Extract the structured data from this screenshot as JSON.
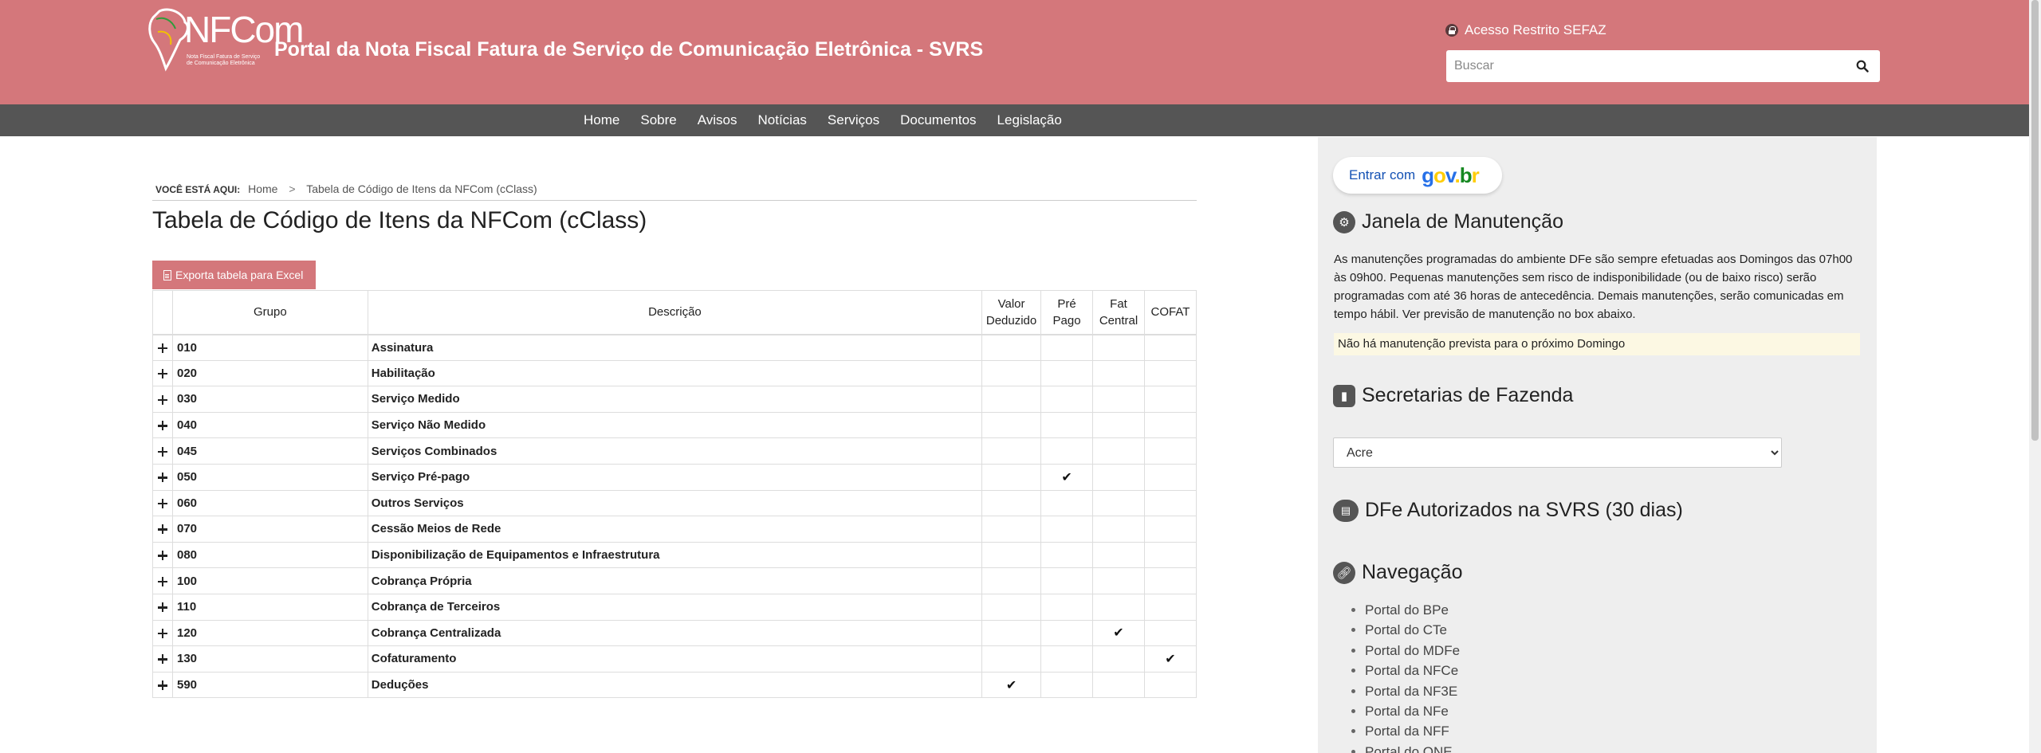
{
  "header": {
    "logo_text": "NFCom",
    "logo_tagline": "Nota Fiscal Fatura de Serviço de Comunicação Eletrônica",
    "portal_title": "Portal da Nota Fiscal Fatura de Serviço de Comunicação Eletrônica - SVRS",
    "restricted_access": "Acesso Restrito SEFAZ",
    "search_placeholder": "Buscar",
    "colors": {
      "header_bg": "#d4777b",
      "nav_bg": "#555555"
    }
  },
  "nav": {
    "items": [
      "Home",
      "Sobre",
      "Avisos",
      "Notícias",
      "Serviços",
      "Documentos",
      "Legislação"
    ]
  },
  "breadcrumb": {
    "label": "VOCÊ ESTÁ AQUI:",
    "home": "Home",
    "separator": ">",
    "current": "Tabela de Código de Itens da NFCom (cClass)"
  },
  "main": {
    "title": "Tabela de Código de Itens da NFCom (cClass)",
    "export_label": "Exporta tabela para Excel",
    "table": {
      "headers": {
        "grupo": "Grupo",
        "descricao": "Descrição",
        "valor_deduzido": [
          "Valor",
          "Deduzido"
        ],
        "pre_pago": [
          "Pré",
          "Pago"
        ],
        "fat_central": [
          "Fat",
          "Central"
        ],
        "cofat": "COFAT"
      },
      "check_glyph": "✔",
      "rows": [
        {
          "grupo": "010",
          "descricao": "Assinatura",
          "valor_deduzido": false,
          "pre_pago": false,
          "fat_central": false,
          "cofat": false
        },
        {
          "grupo": "020",
          "descricao": "Habilitação",
          "valor_deduzido": false,
          "pre_pago": false,
          "fat_central": false,
          "cofat": false
        },
        {
          "grupo": "030",
          "descricao": "Serviço Medido",
          "valor_deduzido": false,
          "pre_pago": false,
          "fat_central": false,
          "cofat": false
        },
        {
          "grupo": "040",
          "descricao": "Serviço Não Medido",
          "valor_deduzido": false,
          "pre_pago": false,
          "fat_central": false,
          "cofat": false
        },
        {
          "grupo": "045",
          "descricao": "Serviços Combinados",
          "valor_deduzido": false,
          "pre_pago": false,
          "fat_central": false,
          "cofat": false
        },
        {
          "grupo": "050",
          "descricao": "Serviço Pré-pago",
          "valor_deduzido": false,
          "pre_pago": true,
          "fat_central": false,
          "cofat": false
        },
        {
          "grupo": "060",
          "descricao": "Outros Serviços",
          "valor_deduzido": false,
          "pre_pago": false,
          "fat_central": false,
          "cofat": false
        },
        {
          "grupo": "070",
          "descricao": "Cessão Meios de Rede",
          "valor_deduzido": false,
          "pre_pago": false,
          "fat_central": false,
          "cofat": false
        },
        {
          "grupo": "080",
          "descricao": "Disponibilização de Equipamentos e Infraestrutura",
          "valor_deduzido": false,
          "pre_pago": false,
          "fat_central": false,
          "cofat": false
        },
        {
          "grupo": "100",
          "descricao": "Cobrança Própria",
          "valor_deduzido": false,
          "pre_pago": false,
          "fat_central": false,
          "cofat": false
        },
        {
          "grupo": "110",
          "descricao": "Cobrança de Terceiros",
          "valor_deduzido": false,
          "pre_pago": false,
          "fat_central": false,
          "cofat": false
        },
        {
          "grupo": "120",
          "descricao": "Cobrança Centralizada",
          "valor_deduzido": false,
          "pre_pago": false,
          "fat_central": true,
          "cofat": false
        },
        {
          "grupo": "130",
          "descricao": "Cofaturamento",
          "valor_deduzido": false,
          "pre_pago": false,
          "fat_central": false,
          "cofat": true
        },
        {
          "grupo": "590",
          "descricao": "Deduções",
          "valor_deduzido": true,
          "pre_pago": false,
          "fat_central": false,
          "cofat": false
        }
      ]
    }
  },
  "sidebar": {
    "govbr": {
      "enter_label": "Entrar com",
      "brand": "gov.br"
    },
    "maintenance": {
      "title": "Janela de Manutenção",
      "text": "As manutenções programadas do ambiente DFe são sempre efetuadas aos Domingos das 07h00 às 09h00. Pequenas manutenções sem risco de indisponibilidade (ou de baixo risco) serão programadas com até 36 horas de antecedência. Demais manutenções, serão comunicadas em tempo hábil. Ver previsão de manutenção no box abaixo.",
      "notice": "Não há manutenção prevista para o próximo Domingo"
    },
    "secretarias": {
      "title": "Secretarias de Fazenda",
      "selected": "Acre"
    },
    "dfe": {
      "title": "DFe Autorizados na SVRS (30 dias)"
    },
    "navegacao": {
      "title": "Navegação",
      "links": [
        "Portal do BPe",
        "Portal do CTe",
        "Portal do MDFe",
        "Portal da NFCe",
        "Portal da NF3E",
        "Portal da NFe",
        "Portal da NFF",
        "Portal do ONE"
      ]
    }
  }
}
